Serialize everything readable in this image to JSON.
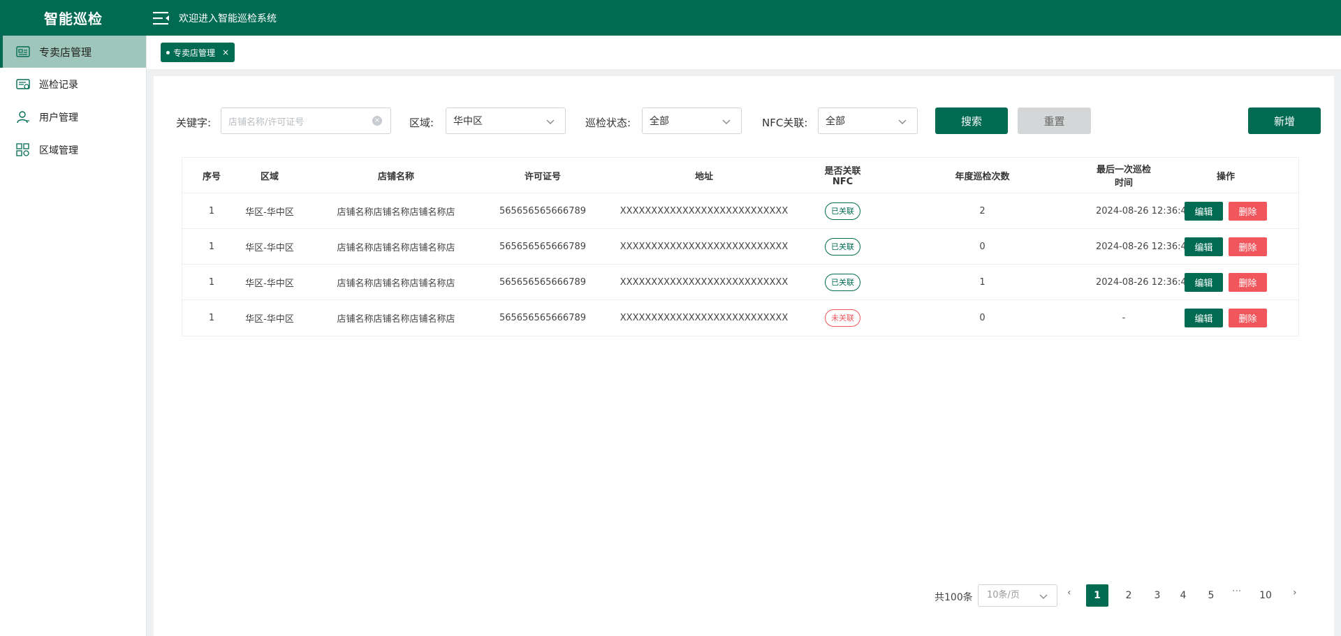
{
  "app": {
    "brand": "智能巡检",
    "welcome": "欢迎进入智能巡检系统"
  },
  "sidebar": {
    "items": [
      {
        "label": "专卖店管理",
        "icon": "store-card-icon",
        "active": true
      },
      {
        "label": "巡检记录",
        "icon": "inspection-record-icon",
        "active": false
      },
      {
        "label": "用户管理",
        "icon": "user-icon",
        "active": false
      },
      {
        "label": "区域管理",
        "icon": "region-grid-icon",
        "active": false
      }
    ]
  },
  "tabs": [
    {
      "label": "专卖店管理",
      "close": "×"
    }
  ],
  "filters": {
    "keyword_label": "关键字:",
    "keyword_placeholder": "店铺名称/许可证号",
    "keyword_value": "",
    "region_label": "区域:",
    "region_value": "华中区",
    "status_label": "巡检状态:",
    "status_value": "全部",
    "nfc_label": "NFC关联:",
    "nfc_value": "全部",
    "search_button": "搜索",
    "reset_button": "重置",
    "add_button": "新增"
  },
  "table": {
    "headers": [
      "序号",
      "区域",
      "店铺名称",
      "许可证号",
      "地址",
      "是否关联NFC",
      "年度巡检次数",
      "最后一次巡检时间",
      "操作"
    ],
    "rows": [
      {
        "index": "1",
        "region": "华区-华中区",
        "name": "店铺名称店铺名称店铺名称店",
        "license": "565656565666789",
        "address": "XXXXXXXXXXXXXXXXXXXXXXXXXXX",
        "nfc": "已关联",
        "nfc_linked": true,
        "count": "2",
        "last_time": "2024-08-26 12:36:45"
      },
      {
        "index": "1",
        "region": "华区-华中区",
        "name": "店铺名称店铺名称店铺名称店",
        "license": "565656565666789",
        "address": "XXXXXXXXXXXXXXXXXXXXXXXXXXX",
        "nfc": "已关联",
        "nfc_linked": true,
        "count": "0",
        "last_time": "2024-08-26 12:36:45"
      },
      {
        "index": "1",
        "region": "华区-华中区",
        "name": "店铺名称店铺名称店铺名称店",
        "license": "565656565666789",
        "address": "XXXXXXXXXXXXXXXXXXXXXXXXXXX",
        "nfc": "已关联",
        "nfc_linked": true,
        "count": "1",
        "last_time": "2024-08-26 12:36:45"
      },
      {
        "index": "1",
        "region": "华区-华中区",
        "name": "店铺名称店铺名称店铺名称店",
        "license": "565656565666789",
        "address": "XXXXXXXXXXXXXXXXXXXXXXXXXXX",
        "nfc": "未关联",
        "nfc_linked": false,
        "count": "0",
        "last_time": "-"
      }
    ],
    "edit_label": "编辑",
    "delete_label": "删除"
  },
  "pagination": {
    "total": "共100条",
    "page_size": "10条/页",
    "pages": [
      "1",
      "2",
      "3",
      "4",
      "5"
    ],
    "ellipsis": "···",
    "last_page": "10",
    "current": "1",
    "prev": "‹",
    "next": "›"
  },
  "colors": {
    "primary": "#006b52",
    "danger": "#f0565c",
    "sidebar_active": "#9ec6ba"
  }
}
